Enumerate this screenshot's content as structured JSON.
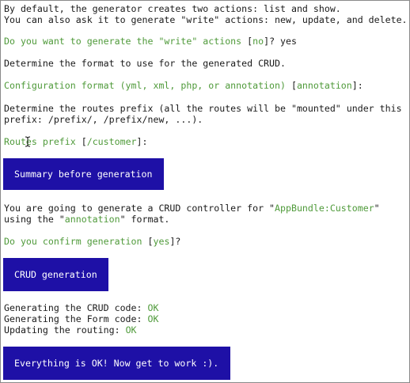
{
  "intro": {
    "line1": "By default, the generator creates two actions: list and show.",
    "line2": "You can also ask it to generate \"write\" actions: new, update, and delete."
  },
  "write_question": {
    "prompt": "Do you want to generate the \"write\" actions",
    "default_open": " [",
    "default": "no",
    "default_close": "]? ",
    "answer": "yes"
  },
  "format_intro": "Determine the format to use for the generated CRUD.",
  "format_question": {
    "prompt": "Configuration format (yml, xml, php, or annotation)",
    "default_open": " [",
    "default": "annotation",
    "default_close": "]:"
  },
  "routes_intro": {
    "line1": "Determine the routes prefix (all the routes will be \"mounted\" under this",
    "line2": "prefix: /prefix/, /prefix/new, ...)."
  },
  "routes_question": {
    "prompt": "Routes prefix",
    "default_open": " [",
    "default": "/customer",
    "default_close": "]:"
  },
  "summary_block": "Summary before generation",
  "generate_info": {
    "line1_start": "You are going to generate a CRUD controller for \"",
    "entity": "AppBundle:Customer",
    "line1_end": "\"",
    "line2_start": "using the \"",
    "format": "annotation",
    "line2_end": "\" format."
  },
  "confirm_question": {
    "prompt": "Do you confirm generation",
    "default_open": " [",
    "default": "yes",
    "default_close": "]?"
  },
  "crud_block": "CRUD generation",
  "results": [
    {
      "label": "Generating the CRUD code: ",
      "status": "OK"
    },
    {
      "label": "Generating the Form code: ",
      "status": "OK"
    },
    {
      "label": "Updating the routing: ",
      "status": "OK"
    }
  ],
  "success_block": "Everything is OK! Now get to work :).",
  "colors": {
    "prompt_green": "#4f9a3a",
    "block_blue": "#1e10a6",
    "text": "#1a1a1a"
  }
}
